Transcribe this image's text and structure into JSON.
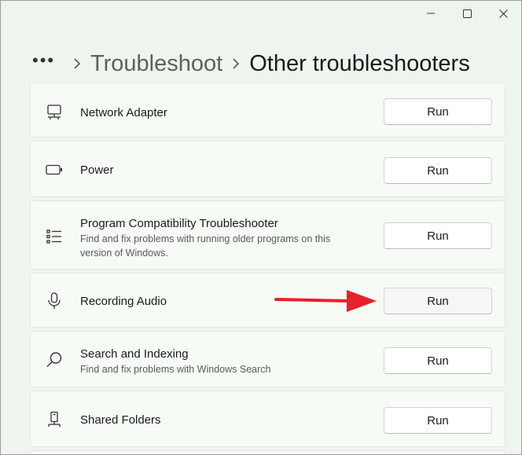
{
  "window": {
    "controls": {
      "minimize": "minimize-icon",
      "maximize": "maximize-icon",
      "close": "close-icon"
    }
  },
  "header": {
    "more_label": "•••",
    "parent": "Troubleshoot",
    "current": "Other troubleshooters"
  },
  "items": [
    {
      "title": "Network Adapter",
      "description": "",
      "icon": "network-adapter-icon",
      "button": "Run"
    },
    {
      "title": "Power",
      "description": "",
      "icon": "battery-icon",
      "button": "Run"
    },
    {
      "title": "Program Compatibility Troubleshooter",
      "description": "Find and fix problems with running older programs on this version of Windows.",
      "icon": "list-icon",
      "button": "Run"
    },
    {
      "title": "Recording Audio",
      "description": "",
      "icon": "microphone-icon",
      "button": "Run"
    },
    {
      "title": "Search and Indexing",
      "description": "Find and fix problems with Windows Search",
      "icon": "search-icon",
      "button": "Run"
    },
    {
      "title": "Shared Folders",
      "description": "",
      "icon": "shared-folder-icon",
      "button": "Run"
    }
  ],
  "annotation": {
    "arrow_color": "#e8202a",
    "points_to": "Recording Audio"
  }
}
